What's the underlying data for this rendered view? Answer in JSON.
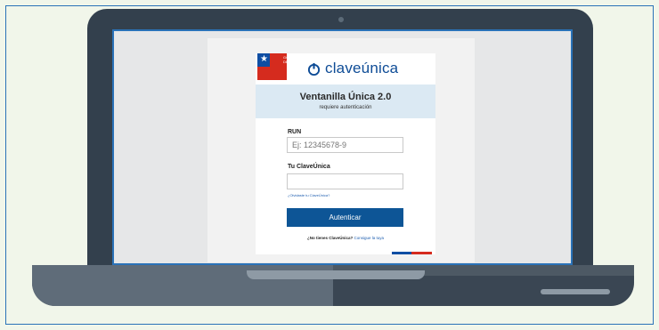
{
  "gov_logo_text": "GOBIERNO DE CHILE",
  "brand": {
    "name": "claveúnica",
    "icon": "power-icon"
  },
  "banner": {
    "title": "Ventanilla Única 2.0",
    "subtitle": "requiere autenticación"
  },
  "form": {
    "run_label": "RUN",
    "run_placeholder": "Ej: 12345678-9",
    "run_value": "",
    "clave_label": "Tu ClaveÚnica",
    "clave_value": "",
    "forgot_link": "¿Olvidaste tu ClaveÚnica?",
    "submit_label": "Autenticar"
  },
  "footer": {
    "question": "¿No tienes ClaveÚnica?",
    "link": "Consigue la tuya"
  },
  "colors": {
    "primary": "#0d5596",
    "banner": "#dbe9f3",
    "flag_blue": "#0f4ea3",
    "flag_red": "#d52b1e",
    "laptop": "#33404d"
  }
}
